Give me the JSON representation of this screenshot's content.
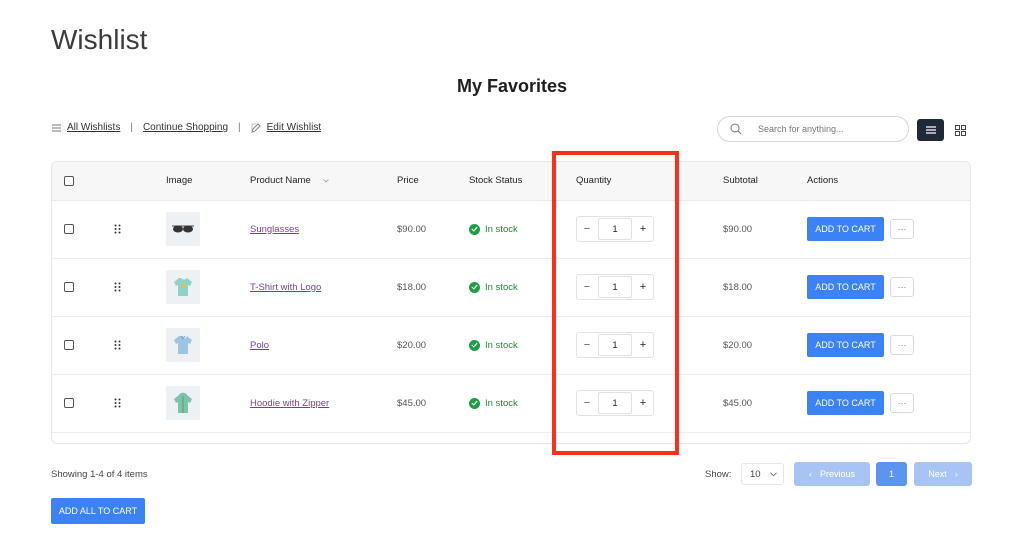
{
  "page": {
    "title": "Wishlist",
    "list_title": "My Favorites"
  },
  "toolbar": {
    "all_wishlists": "All Wishlists",
    "continue_shopping": "Continue Shopping",
    "edit_wishlist": "Edit Wishlist",
    "search_placeholder": "Search for anything..."
  },
  "table": {
    "headers": {
      "image": "Image",
      "product_name": "Product Name",
      "price": "Price",
      "stock_status": "Stock Status",
      "quantity": "Quantity",
      "subtotal": "Subtotal",
      "actions": "Actions"
    },
    "rows": [
      {
        "name": "Sunglasses",
        "price": "$90.00",
        "stock": "In stock",
        "qty": "1",
        "subtotal": "$90.00",
        "action": "ADD TO CART",
        "minus": "−",
        "plus": "+"
      },
      {
        "name": "T-Shirt with Logo",
        "price": "$18.00",
        "stock": "In stock",
        "qty": "1",
        "subtotal": "$18.00",
        "action": "ADD TO CART",
        "minus": "−",
        "plus": "+"
      },
      {
        "name": "Polo",
        "price": "$20.00",
        "stock": "In stock",
        "qty": "1",
        "subtotal": "$20.00",
        "action": "ADD TO CART",
        "minus": "−",
        "plus": "+"
      },
      {
        "name": "Hoodie with Zipper",
        "price": "$45.00",
        "stock": "In stock",
        "qty": "1",
        "subtotal": "$45.00",
        "action": "ADD TO CART",
        "minus": "−",
        "plus": "+"
      }
    ]
  },
  "footer": {
    "showing": "Showing 1-4 of 4 items",
    "show_label": "Show:",
    "per_page": "10",
    "previous": "Previous",
    "current_page": "1",
    "next": "Next",
    "add_all": "ADD ALL TO CART"
  },
  "colors": {
    "accent": "#3b82f6",
    "highlight": "#ff2d1c",
    "in_stock": "#1f9d45",
    "link": "#7a3d9e"
  }
}
